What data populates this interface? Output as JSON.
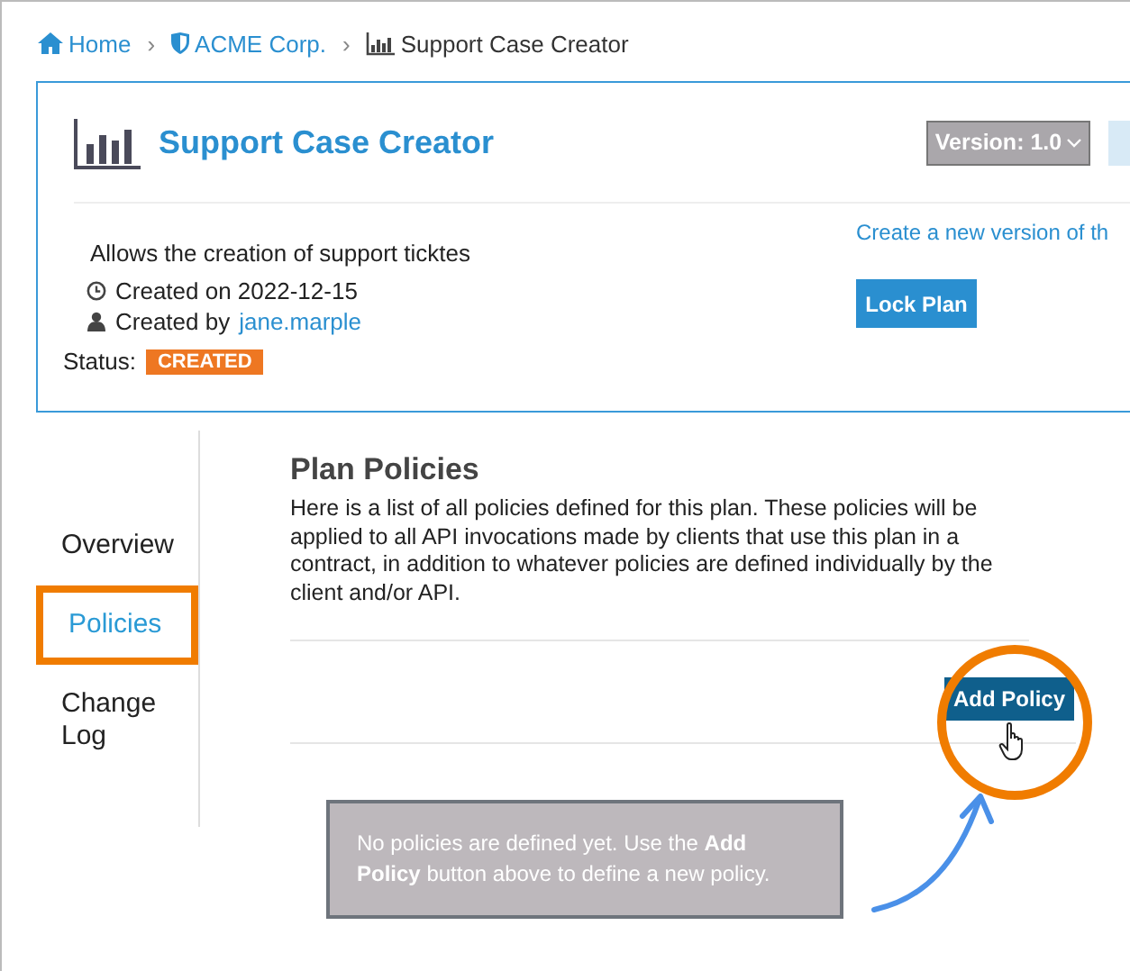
{
  "breadcrumb": [
    {
      "label": "Home",
      "current": false,
      "separator": "›"
    },
    {
      "label": "ACME Corp.",
      "current": false,
      "separator": "›"
    },
    {
      "label": "Support Case Creator",
      "current": true
    }
  ],
  "plan": {
    "title": "Support Case Creator",
    "version": "Version: 1.0",
    "description": "Allows the creation of support ticktes",
    "created_on": "Created on 2022-12-15",
    "created_by": "Created by",
    "created_by_user": "jane.marple",
    "status_label": "Status:",
    "status": "CREATED",
    "new_version_link": "Create a new version of th",
    "lock_button": "Lock Plan"
  },
  "sidebar": {
    "items": [
      {
        "label": "Overview",
        "selected": false
      },
      {
        "label": "Policies",
        "selected": true
      },
      {
        "label": "Change Log",
        "selected": false
      }
    ]
  },
  "policies": {
    "title": "Plan Policies",
    "description": "Here is a list of all policies defined for this plan. These policies will be applied to all API invocations made by clients that use this plan in a contract, in addition to whatever policies are defined individually by the client and/or API.",
    "add_button": "Add Policy",
    "empty_message": "No policies are defined yet. Use the **Add Policy** button above to define a new policy."
  }
}
